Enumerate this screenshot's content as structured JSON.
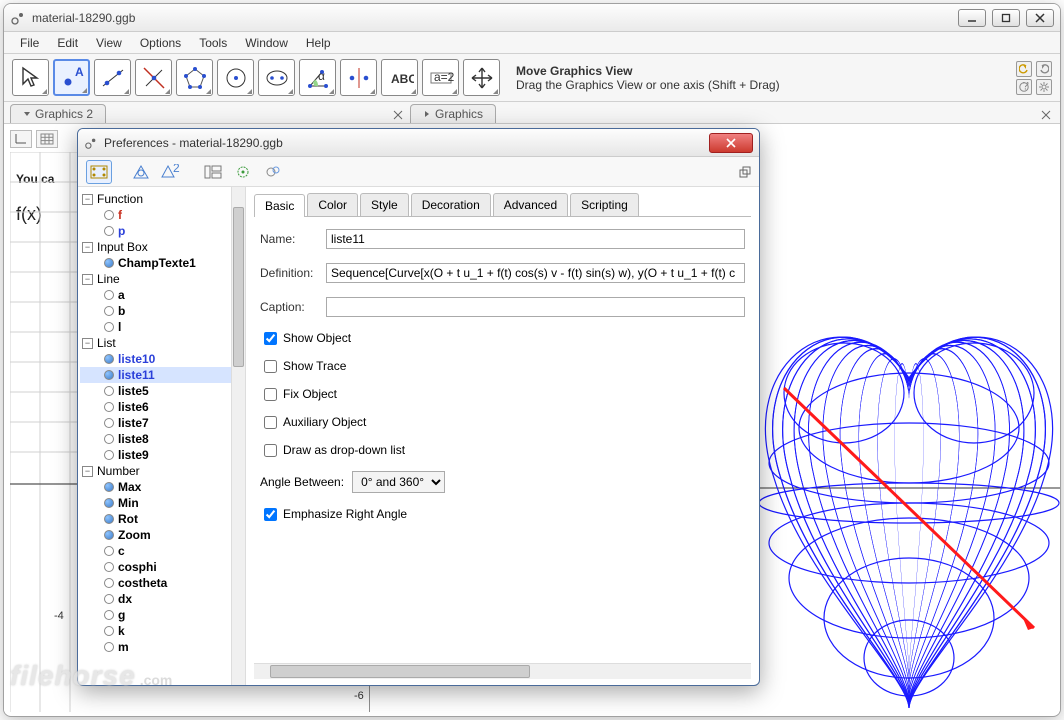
{
  "window": {
    "title": "material-18290.ggb"
  },
  "menu": {
    "file": "File",
    "edit": "Edit",
    "view": "View",
    "options": "Options",
    "tools": "Tools",
    "window": "Window",
    "help": "Help"
  },
  "toolhelp": {
    "title": "Move Graphics View",
    "desc": "Drag the Graphics View or one axis (Shift + Drag)"
  },
  "view_tabs": {
    "graphics2": "Graphics 2",
    "graphics": "Graphics"
  },
  "sidebar_text": {
    "youcan": "You ca",
    "fx": "f(x)"
  },
  "axis_labels": {
    "xneg4": "-4",
    "yneg6": "-6"
  },
  "dialog": {
    "title": "Preferences - material-18290.ggb",
    "tabs": {
      "basic": "Basic",
      "color": "Color",
      "style": "Style",
      "decoration": "Decoration",
      "advanced": "Advanced",
      "scripting": "Scripting"
    },
    "form": {
      "name_label": "Name:",
      "name_value": "liste11",
      "def_label": "Definition:",
      "def_value": "Sequence[Curve[x(O + t u_1 + f(t) cos(s) v - f(t) sin(s) w), y(O + t u_1 + f(t) c",
      "caption_label": "Caption:",
      "caption_value": "",
      "show_object": "Show Object",
      "show_trace": "Show Trace",
      "fix_object": "Fix Object",
      "aux_object": "Auxiliary Object",
      "dropdown": "Draw as drop-down list",
      "angle_label": "Angle Between:",
      "angle_value": "0° and 360°",
      "emph_right": "Emphasize Right Angle"
    },
    "tree": {
      "categories": [
        {
          "name": "Function",
          "items": [
            {
              "label": "f",
              "visible": false,
              "bold": true,
              "color": "red"
            },
            {
              "label": "p",
              "visible": false,
              "bold": true,
              "color": "blue"
            }
          ]
        },
        {
          "name": "Input Box",
          "items": [
            {
              "label": "ChampTexte1",
              "visible": true,
              "bold": true
            }
          ]
        },
        {
          "name": "Line",
          "items": [
            {
              "label": "a",
              "visible": false,
              "bold": true
            },
            {
              "label": "b",
              "visible": false,
              "bold": true
            },
            {
              "label": "l",
              "visible": false,
              "bold": true
            }
          ]
        },
        {
          "name": "List",
          "items": [
            {
              "label": "liste10",
              "visible": true,
              "bold": true,
              "color": "blue"
            },
            {
              "label": "liste11",
              "visible": true,
              "bold": true,
              "color": "blue",
              "selected": true
            },
            {
              "label": "liste5",
              "visible": false,
              "bold": true
            },
            {
              "label": "liste6",
              "visible": false,
              "bold": true
            },
            {
              "label": "liste7",
              "visible": false,
              "bold": true
            },
            {
              "label": "liste8",
              "visible": false,
              "bold": true
            },
            {
              "label": "liste9",
              "visible": false,
              "bold": true
            }
          ]
        },
        {
          "name": "Number",
          "items": [
            {
              "label": "Max",
              "visible": true,
              "bold": true
            },
            {
              "label": "Min",
              "visible": true,
              "bold": true
            },
            {
              "label": "Rot",
              "visible": true,
              "bold": true
            },
            {
              "label": "Zoom",
              "visible": true,
              "bold": true
            },
            {
              "label": "c",
              "visible": false,
              "bold": true
            },
            {
              "label": "cosphi",
              "visible": false,
              "bold": true
            },
            {
              "label": "costheta",
              "visible": false,
              "bold": true
            },
            {
              "label": "dx",
              "visible": false,
              "bold": true
            },
            {
              "label": "g",
              "visible": false,
              "bold": true
            },
            {
              "label": "k",
              "visible": false,
              "bold": true
            },
            {
              "label": "m",
              "visible": false,
              "bold": true
            }
          ]
        }
      ]
    }
  },
  "watermark": {
    "brand": "filehorse",
    "tld": ".com"
  }
}
